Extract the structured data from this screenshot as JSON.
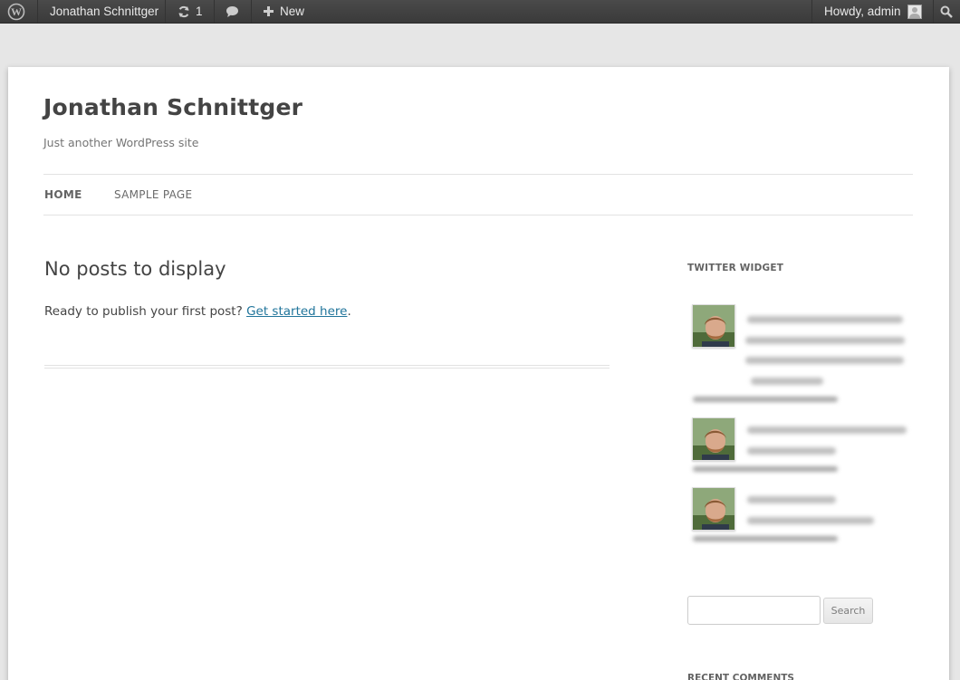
{
  "adminbar": {
    "site_name": "Jonathan Schnittger",
    "updates_count": "1",
    "new_label": "New",
    "howdy": "Howdy, admin"
  },
  "site": {
    "title": "Jonathan Schnittger",
    "description": "Just another WordPress site"
  },
  "nav": {
    "items": [
      {
        "label": "HOME"
      },
      {
        "label": "SAMPLE PAGE"
      }
    ]
  },
  "main": {
    "heading": "No posts to display",
    "prompt_text": "Ready to publish your first post?",
    "link_text": "Get started here",
    "period": "."
  },
  "sidebar": {
    "twitter_title": "TWITTER WIDGET",
    "search_button": "Search",
    "search_value": "",
    "recent_comments_title": "RECENT COMMENTS"
  },
  "colors": {
    "link": "#21759b",
    "adminbar_bg": "#464646",
    "page_bg": "#e6e6e6"
  }
}
